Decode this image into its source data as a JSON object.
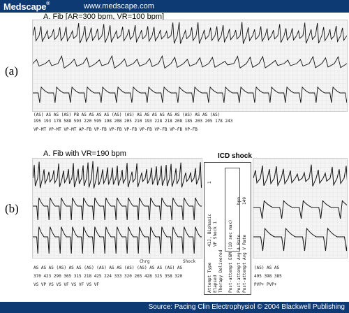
{
  "header": {
    "logo": "Medscape",
    "logo_mark": "®",
    "url": "www.medscape.com",
    "bg_color": "#0e3a73"
  },
  "panel_a": {
    "label": "(a)",
    "title": "A. Fib [AR=300 bpm, VR=100 bpm]",
    "marker_row_1": "(AS) AS  AS (AS)  PB  AS  AS AS AS (AS) (AS) AS AS  AS AS AS AS (AS) AS AS (AS)",
    "marker_row_2": "195 193 178 588 593 220  595 198 208 205 210 193 228  218 208 185 203 205 178 243",
    "marker_row_3": "VP-MT   VP-MT  VP-MT   AP-FB  VP-FB   VP-FB  VP-FB  VP-FB  VP-FB  VP-FB  VP-FB"
  },
  "panel_b": {
    "label": "(b)",
    "title": "A. Fib with VR=190 bpm",
    "icd_title": "ICD shock",
    "chrg": "Chrg",
    "shock": "Shock",
    "marker_row_1": "AS AS  AS (AS) AS  AS (AS) (AS) AS AS (AS) (AS) AS AS (AS) AS",
    "marker_row_2": "370 423 290 365 315 218 425 224 333 320 265 428 325 358 320",
    "marker_row_3": "VS  VP   VS   VS   VF   VS   VF   VS    VF",
    "annotations": [
      "41J, Biphasic",
      "VF Shock 1",
      "Attempt Type",
      "Elapsed",
      "Therapy Delivered",
      "Post-attempt EGM (10 sec max)",
      "Post-attempt Avg A Rate",
      "Post-attempt Avg V Rate"
    ],
    "values": [
      "bpm",
      "149"
    ],
    "attempt_num": "1",
    "after_row_1": "(AS)     AS    AS",
    "after_row_2": "495    398    385",
    "after_row_3": "PVP+     PVP+"
  },
  "footer": {
    "source": "Source: Pacing Clin Electrophysiol © 2004 Blackwell Publishing"
  }
}
